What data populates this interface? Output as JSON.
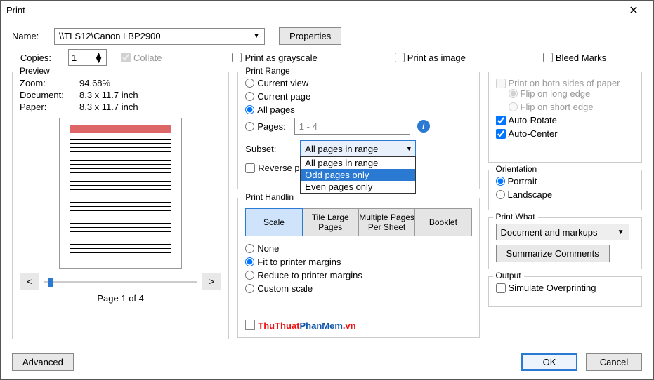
{
  "window": {
    "title": "Print"
  },
  "header": {
    "name_label": "Name:",
    "printer": "\\\\TLS12\\Canon LBP2900",
    "properties_btn": "Properties",
    "copies_label": "Copies:",
    "copies_value": "1",
    "collate": "Collate",
    "grayscale": "Print as grayscale",
    "as_image": "Print as image",
    "bleed": "Bleed Marks"
  },
  "preview": {
    "legend": "Preview",
    "zoom_label": "Zoom:",
    "zoom_value": "94.68%",
    "doc_label": "Document:",
    "doc_value": "8.3 x 11.7 inch",
    "paper_label": "Paper:",
    "paper_value": "8.3 x 11.7 inch",
    "prev_btn": "<",
    "next_btn": ">",
    "page_status": "Page 1 of 4"
  },
  "range": {
    "legend": "Print Range",
    "current_view": "Current view",
    "current_page": "Current page",
    "all_pages": "All pages",
    "pages_label": "Pages:",
    "pages_value": "1 - 4",
    "subset_label": "Subset:",
    "subset_value": "All pages in range",
    "subset_options": [
      "All pages in range",
      "Odd pages only",
      "Even pages only"
    ],
    "reverse": "Reverse p"
  },
  "handling": {
    "legend": "Print Handlin",
    "tabs": [
      "Scale",
      "Tile Large Pages",
      "Multiple Pages Per Sheet",
      "Booklet"
    ],
    "none": "None",
    "fit": "Fit to printer margins",
    "reduce": "Reduce to printer margins",
    "custom": "Custom scale"
  },
  "duplex": {
    "both_sides": "Print on both sides of paper",
    "long_edge": "Flip on long edge",
    "short_edge": "Flip on short edge",
    "auto_rotate": "Auto-Rotate",
    "auto_center": "Auto-Center"
  },
  "orientation": {
    "legend": "Orientation",
    "portrait": "Portrait",
    "landscape": "Landscape"
  },
  "print_what": {
    "legend": "Print What",
    "value": "Document and markups",
    "summarize": "Summarize Comments"
  },
  "output": {
    "legend": "Output",
    "simulate": "Simulate Overprinting"
  },
  "footer": {
    "advanced": "Advanced",
    "ok": "OK",
    "cancel": "Cancel"
  },
  "watermark": {
    "part1": "ThuThuat",
    "part2": "PhanMem",
    "part3": ".vn"
  }
}
